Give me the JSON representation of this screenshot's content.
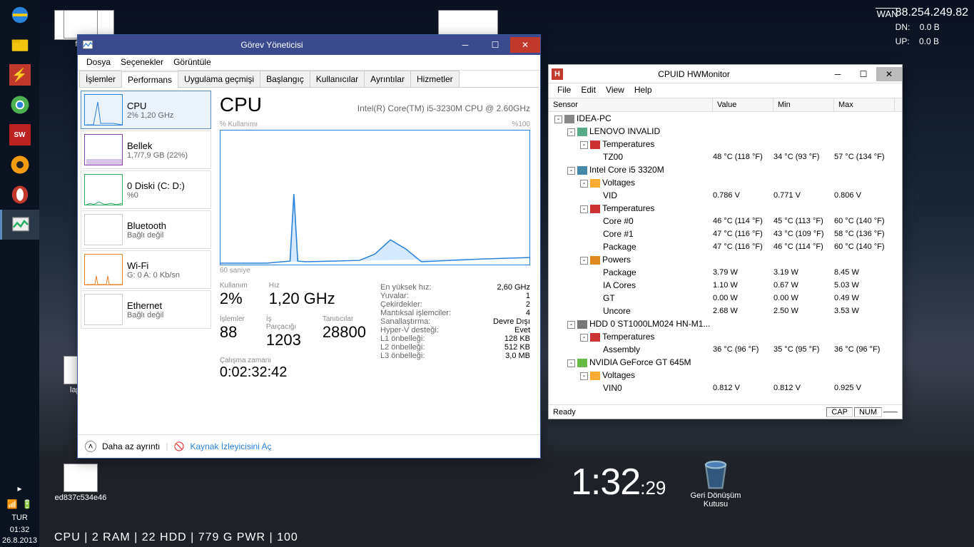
{
  "hud": {
    "ip": "88.254.249.82",
    "dn_label": "DN:",
    "dn_val": "0.0 B",
    "up_label": "UP:",
    "up_val": "0.0 B",
    "wan_label": "WAN",
    "clock_hm": "1:32",
    "clock_s": ":29",
    "bottom": "CPU   |   2            RAM   |   22             HDD   |   779 G           PWR   |   100"
  },
  "taskbar": {
    "lang": "TUR",
    "clock_time": "01:32",
    "clock_date": "26.8.2013"
  },
  "desktop": {
    "icon1": "fan",
    "icon2": "laptop",
    "icon3": "ed837c534e46",
    "recycle": "Geri Dönüşüm Kutusu"
  },
  "tm": {
    "title": "Görev Yöneticisi",
    "menu": {
      "file": "Dosya",
      "options": "Seçenekler",
      "view": "Görüntüle"
    },
    "tabs": {
      "proc": "İşlemler",
      "perf": "Performans",
      "app": "Uygulama geçmişi",
      "startup": "Başlangıç",
      "users": "Kullanıcılar",
      "details": "Ayrıntılar",
      "services": "Hizmetler"
    },
    "side": {
      "cpu_t": "CPU",
      "cpu_s": "2% 1,20 GHz",
      "mem_t": "Bellek",
      "mem_s": "1,7/7,9 GB (22%)",
      "disk_t": "0 Diski (C: D:)",
      "disk_s": "%0",
      "bt_t": "Bluetooth",
      "bt_s": "Bağlı değil",
      "wifi_t": "Wi-Fi",
      "wifi_s": "G: 0 A: 0 Kb/sn",
      "eth_t": "Ethernet",
      "eth_s": "Bağlı değil"
    },
    "main": {
      "label": "CPU",
      "model": "Intel(R) Core(TM) i5-3230M CPU @ 2.60GHz",
      "usage_label": "% Kullanımı",
      "usage_max": "%100",
      "x_label": "60 saniye",
      "k_usage": "Kullanım",
      "v_usage": "2%",
      "k_speed": "Hız",
      "v_speed": "1,20 GHz",
      "k_proc": "İşlemler",
      "v_proc": "88",
      "k_thread": "İş Parçacığı",
      "v_thread": "1203",
      "k_hand": "Tanıtıcılar",
      "v_hand": "28800",
      "k_up": "Çalışma zamanı",
      "v_up": "0:02:32:42",
      "details": [
        {
          "k": "En yüksek hız:",
          "v": "2,60 GHz"
        },
        {
          "k": "Yuvalar:",
          "v": "1"
        },
        {
          "k": "Çekirdekler:",
          "v": "2"
        },
        {
          "k": "Mantıksal işlemciler:",
          "v": "4"
        },
        {
          "k": "Sanallaştırma:",
          "v": "Devre Dışı"
        },
        {
          "k": "Hyper-V desteği:",
          "v": "Evet"
        },
        {
          "k": "L1 önbelleği:",
          "v": "128 KB"
        },
        {
          "k": "L2 önbelleği:",
          "v": "512 KB"
        },
        {
          "k": "L3 önbelleği:",
          "v": "3,0 MB"
        }
      ]
    },
    "bottom": {
      "fewer": "Daha az ayrıntı",
      "resmon": "Kaynak İzleyicisini Aç"
    }
  },
  "hw": {
    "title": "CPUID HWMonitor",
    "menu": {
      "file": "File",
      "edit": "Edit",
      "view": "View",
      "help": "Help"
    },
    "columns": {
      "sensor": "Sensor",
      "value": "Value",
      "min": "Min",
      "max": "Max"
    },
    "rows": [
      {
        "pad": 0,
        "tg": "-",
        "ico": "pc",
        "label": "IDEA-PC"
      },
      {
        "pad": 1,
        "tg": "-",
        "ico": "mb",
        "label": "LENOVO INVALID"
      },
      {
        "pad": 2,
        "tg": "-",
        "ico": "temp",
        "label": "Temperatures"
      },
      {
        "pad": 3,
        "label": "TZ00",
        "val": "48 °C  (118 °F)",
        "min": "34 °C  (93 °F)",
        "max": "57 °C  (134 °F)"
      },
      {
        "pad": 1,
        "tg": "-",
        "ico": "cpu",
        "label": "Intel Core i5 3320M"
      },
      {
        "pad": 2,
        "tg": "-",
        "ico": "volt",
        "label": "Voltages"
      },
      {
        "pad": 3,
        "label": "VID",
        "val": "0.786 V",
        "min": "0.771 V",
        "max": "0.806 V"
      },
      {
        "pad": 2,
        "tg": "-",
        "ico": "temp",
        "label": "Temperatures"
      },
      {
        "pad": 3,
        "label": "Core #0",
        "val": "46 °C  (114 °F)",
        "min": "45 °C  (113 °F)",
        "max": "60 °C  (140 °F)"
      },
      {
        "pad": 3,
        "label": "Core #1",
        "val": "47 °C  (116 °F)",
        "min": "43 °C  (109 °F)",
        "max": "58 °C  (136 °F)"
      },
      {
        "pad": 3,
        "label": "Package",
        "val": "47 °C  (116 °F)",
        "min": "46 °C  (114 °F)",
        "max": "60 °C  (140 °F)"
      },
      {
        "pad": 2,
        "tg": "-",
        "ico": "pwr",
        "label": "Powers"
      },
      {
        "pad": 3,
        "label": "Package",
        "val": "3.79 W",
        "min": "3.19 W",
        "max": "8.45 W"
      },
      {
        "pad": 3,
        "label": "IA Cores",
        "val": "1.10 W",
        "min": "0.67 W",
        "max": "5.03 W"
      },
      {
        "pad": 3,
        "label": "GT",
        "val": "0.00 W",
        "min": "0.00 W",
        "max": "0.49 W"
      },
      {
        "pad": 3,
        "label": "Uncore",
        "val": "2.68 W",
        "min": "2.50 W",
        "max": "3.53 W"
      },
      {
        "pad": 1,
        "tg": "-",
        "ico": "hdd",
        "label": "HDD 0 ST1000LM024 HN-M1..."
      },
      {
        "pad": 2,
        "tg": "-",
        "ico": "temp",
        "label": "Temperatures"
      },
      {
        "pad": 3,
        "label": "Assembly",
        "val": "36 °C  (96 °F)",
        "min": "35 °C  (95 °F)",
        "max": "36 °C  (96 °F)"
      },
      {
        "pad": 1,
        "tg": "-",
        "ico": "gpu",
        "label": "NVIDIA GeForce GT 645M"
      },
      {
        "pad": 2,
        "tg": "-",
        "ico": "volt",
        "label": "Voltages"
      },
      {
        "pad": 3,
        "label": "VIN0",
        "val": "0.812 V",
        "min": "0.812 V",
        "max": "0.925 V"
      }
    ],
    "status": {
      "ready": "Ready",
      "cap": "CAP",
      "num": "NUM"
    }
  },
  "chart_data": {
    "type": "line",
    "title": "CPU % Kullanımı",
    "xlabel": "60 saniye",
    "ylabel": "%",
    "ylim": [
      0,
      100
    ],
    "x": [
      0,
      5,
      10,
      15,
      20,
      25,
      30,
      35,
      40,
      45,
      50,
      55,
      60
    ],
    "values": [
      0,
      0,
      2,
      2,
      48,
      3,
      2,
      5,
      18,
      12,
      2,
      3,
      5
    ]
  }
}
